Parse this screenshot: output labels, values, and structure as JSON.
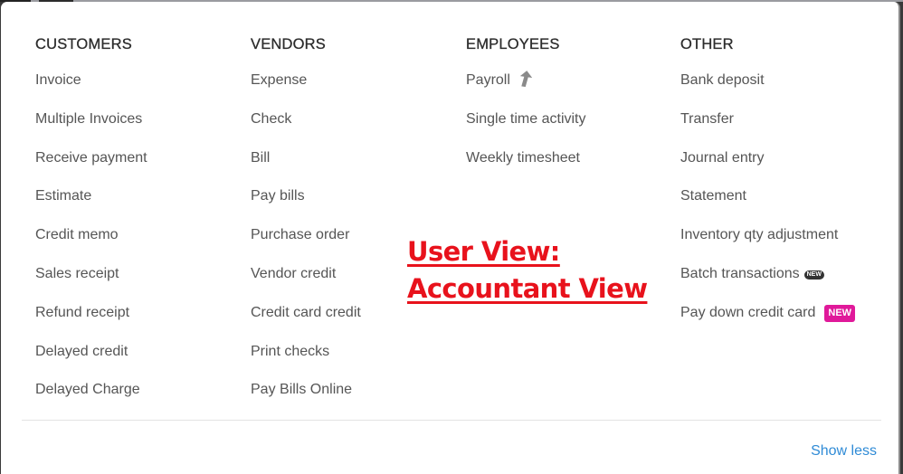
{
  "menu": {
    "columns": [
      {
        "heading": "CUSTOMERS",
        "items": [
          {
            "label": "Invoice"
          },
          {
            "label": "Multiple Invoices"
          },
          {
            "label": "Receive payment"
          },
          {
            "label": "Estimate"
          },
          {
            "label": "Credit memo"
          },
          {
            "label": "Sales receipt"
          },
          {
            "label": "Refund receipt"
          },
          {
            "label": "Delayed credit"
          },
          {
            "label": "Delayed Charge"
          }
        ]
      },
      {
        "heading": "VENDORS",
        "items": [
          {
            "label": "Expense"
          },
          {
            "label": "Check"
          },
          {
            "label": "Bill"
          },
          {
            "label": "Pay bills"
          },
          {
            "label": "Purchase order"
          },
          {
            "label": "Vendor credit"
          },
          {
            "label": "Credit card credit"
          },
          {
            "label": "Print checks"
          },
          {
            "label": "Pay Bills Online"
          }
        ]
      },
      {
        "heading": "EMPLOYEES",
        "items": [
          {
            "label": "Payroll",
            "icon": "upgrade-arrow-icon"
          },
          {
            "label": "Single time activity"
          },
          {
            "label": "Weekly timesheet"
          }
        ]
      },
      {
        "heading": "OTHER",
        "items": [
          {
            "label": "Bank deposit"
          },
          {
            "label": "Transfer"
          },
          {
            "label": "Journal entry"
          },
          {
            "label": "Statement"
          },
          {
            "label": "Inventory qty adjustment"
          },
          {
            "label": "Batch transactions",
            "badge": "NEW",
            "badge_style": "small-dark"
          },
          {
            "label": "Pay down credit card",
            "badge": "NEW",
            "badge_style": "magenta",
            "badge_color": "#e0199a"
          }
        ]
      }
    ],
    "show_less_label": "Show less"
  },
  "annotation": {
    "line1": "User View:",
    "line2": "Accountant View",
    "color": "#e8121c"
  }
}
